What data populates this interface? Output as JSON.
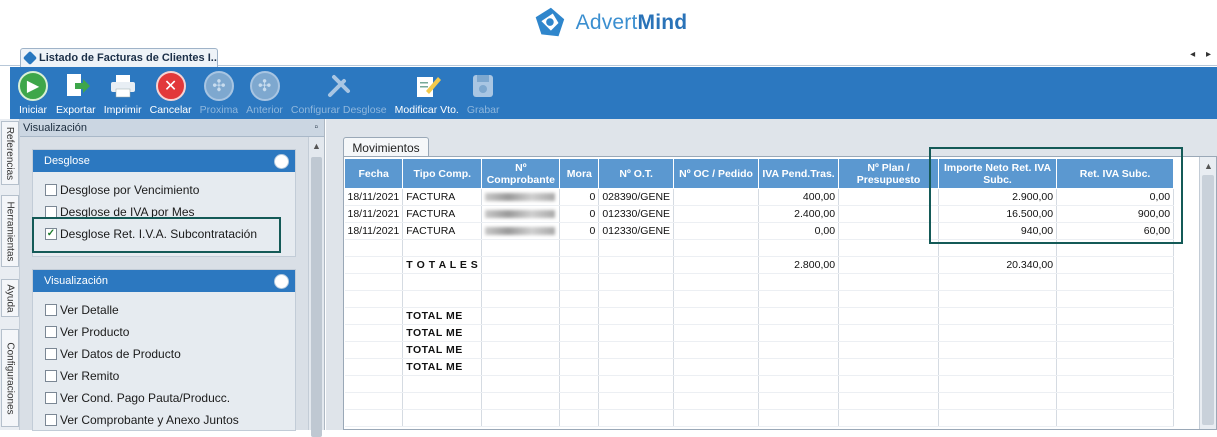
{
  "brand": {
    "name_light": "Advert",
    "name_bold": "Mind",
    "accent": "#2c78c0"
  },
  "window": {
    "tab_title": "Listado de Facturas de Clientes I...",
    "tab_arrows": "◂ ▸"
  },
  "toolbar": {
    "buttons": [
      {
        "label": "Iniciar",
        "icon": "play-icon",
        "enabled": true
      },
      {
        "label": "Exportar",
        "icon": "export-icon",
        "enabled": true
      },
      {
        "label": "Imprimir",
        "icon": "printer-icon",
        "enabled": true
      },
      {
        "label": "Cancelar",
        "icon": "cancel-icon",
        "enabled": true
      },
      {
        "label": "Proxima",
        "icon": "next-icon",
        "enabled": false
      },
      {
        "label": "Anterior",
        "icon": "previous-icon",
        "enabled": false
      },
      {
        "label": "Configurar Desglose",
        "icon": "tools-icon",
        "enabled": false
      },
      {
        "label": "Modificar Vto.",
        "icon": "edit-icon",
        "enabled": true
      },
      {
        "label": "Grabar",
        "icon": "save-icon",
        "enabled": false
      }
    ]
  },
  "left_tabs": [
    "Referencias",
    "Herramientas",
    "Ayuda",
    "Configuraciones"
  ],
  "sidebar": {
    "title": "Visualización",
    "pin": "▫",
    "panels": [
      {
        "title": "Desglose",
        "options": [
          {
            "label": "Desglose por Vencimiento",
            "checked": false
          },
          {
            "label": "Desglose de IVA por Mes",
            "checked": false
          },
          {
            "label": "Desglose Ret.  I.V.A. Subcontratación",
            "checked": true
          }
        ]
      },
      {
        "title": "Visualización",
        "options": [
          {
            "label": "Ver Detalle",
            "checked": false
          },
          {
            "label": "Ver Producto",
            "checked": false
          },
          {
            "label": "Ver Datos de Producto",
            "checked": false
          },
          {
            "label": "Ver Remito",
            "checked": false
          },
          {
            "label": "Ver Cond. Pago Pauta/Producc.",
            "checked": false
          },
          {
            "label": "Ver Comprobante y Anexo Juntos",
            "checked": false
          }
        ]
      }
    ]
  },
  "main": {
    "tab_label": "Movimientos",
    "columns": [
      "Fecha",
      "Tipo Comp.",
      "Nº Comprobante",
      "Mora",
      "Nº O.T.",
      "Nº OC / Pedido",
      "IVA Pend.Tras.",
      "Nº Plan / Presupuesto",
      "Importe Neto Ret. IVA Subc.",
      "Ret. IVA Subc."
    ],
    "rows": [
      [
        "18/11/2021",
        "FACTURA",
        "",
        "0",
        "028390/GENE",
        "",
        "400,00",
        "",
        "2.900,00",
        "0,00"
      ],
      [
        "18/11/2021",
        "FACTURA",
        "",
        "0",
        "012330/GENE",
        "",
        "2.400,00",
        "",
        "16.500,00",
        "900,00"
      ],
      [
        "18/11/2021",
        "FACTURA",
        "",
        "0",
        "012330/GENE",
        "",
        "0,00",
        "",
        "940,00",
        "60,00"
      ],
      [
        "",
        "",
        "",
        "",
        "",
        "",
        "",
        "",
        "",
        ""
      ],
      [
        "",
        "T O T A L E S",
        "",
        "",
        "",
        "",
        "2.800,00",
        "",
        "20.340,00",
        ""
      ],
      [
        "",
        "",
        "",
        "",
        "",
        "",
        "",
        "",
        "",
        ""
      ],
      [
        "",
        "",
        "",
        "",
        "",
        "",
        "",
        "",
        "",
        ""
      ],
      [
        "",
        "TOTAL ME",
        "",
        "",
        "",
        "",
        "",
        "",
        "",
        ""
      ],
      [
        "",
        "TOTAL ME",
        "",
        "",
        "",
        "",
        "",
        "",
        "",
        ""
      ],
      [
        "",
        "TOTAL ME",
        "",
        "",
        "",
        "",
        "",
        "",
        "",
        ""
      ],
      [
        "",
        "TOTAL ME",
        "",
        "",
        "",
        "",
        "",
        "",
        "",
        ""
      ],
      [
        "",
        "",
        "",
        "",
        "",
        "",
        "",
        "",
        "",
        ""
      ],
      [
        "",
        "",
        "",
        "",
        "",
        "",
        "",
        "",
        "",
        ""
      ],
      [
        "",
        "",
        "",
        "",
        "",
        "",
        "",
        "",
        "",
        ""
      ]
    ]
  }
}
